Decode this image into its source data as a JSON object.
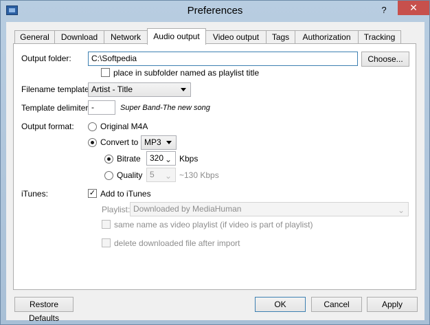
{
  "window": {
    "title": "Preferences",
    "help": "?",
    "close": "✕"
  },
  "tabs": [
    "General",
    "Download",
    "Network",
    "Audio output",
    "Video output",
    "Tags",
    "Authorization",
    "Tracking"
  ],
  "output_folder": {
    "label": "Output folder:",
    "value": "C:\\Softpedia",
    "choose": "Choose...",
    "subfolder_label": "place in subfolder named as playlist title",
    "subfolder_checked": false
  },
  "filename_template": {
    "label": "Filename template:",
    "value": "Artist - Title"
  },
  "template_delimiter": {
    "label": "Template delimiter:",
    "value": "-",
    "example": "Super Band-The new song"
  },
  "output_format": {
    "label": "Output format:",
    "original": "Original M4A",
    "convert_to": "Convert to",
    "format": "MP3",
    "bitrate_label": "Bitrate",
    "bitrate_value": "320",
    "bitrate_unit": "Kbps",
    "quality_label": "Quality",
    "quality_value": "5",
    "quality_hint": "~130 Kbps"
  },
  "itunes": {
    "label": "iTunes:",
    "add_label": "Add to iTunes",
    "add_checked": true,
    "playlist_label": "Playlist:",
    "playlist_value": "Downloaded by MediaHuman",
    "same_name_label": "same name as video playlist (if video is part of playlist)",
    "delete_label": "delete downloaded file after import"
  },
  "footer": {
    "restore": "Restore Defaults",
    "ok": "OK",
    "cancel": "Cancel",
    "apply": "Apply"
  }
}
